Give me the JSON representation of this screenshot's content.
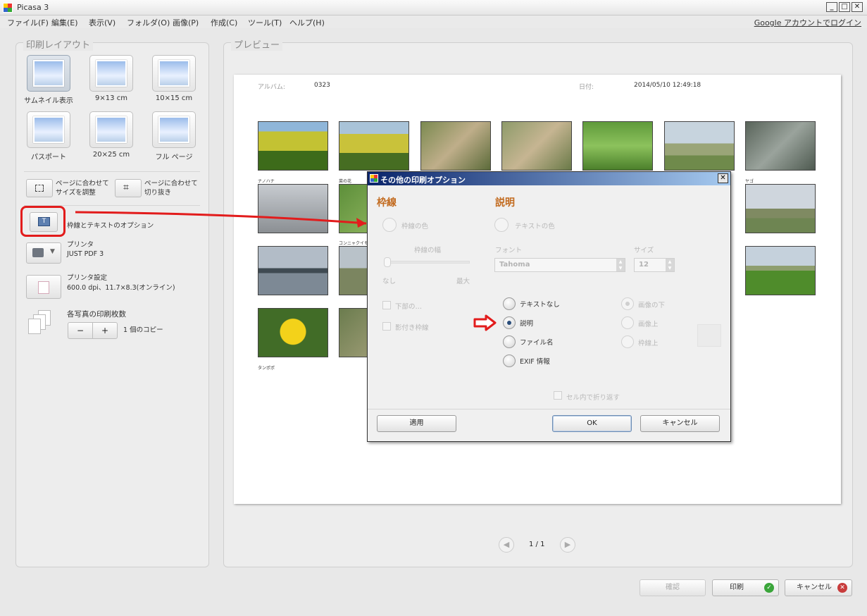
{
  "window": {
    "title": "Picasa 3"
  },
  "menu": [
    "ファイル(F)",
    "編集(E)",
    "表示(V)",
    "フォルダ(O)",
    "画像(P)",
    "作成(C)",
    "ツール(T)",
    "ヘルプ(H)"
  ],
  "login_link": "Google アカウントでログイン",
  "left": {
    "title": "印刷レイアウト",
    "layouts": [
      "サムネイル表示",
      "9×13 cm",
      "10×15 cm",
      "パスポート",
      "20×25 cm",
      "フル ページ"
    ],
    "fit_resize": "ページに合わせてサイズを調整",
    "fit_crop": "ページに合わせて切り抜き",
    "border_text": "枠線とテキストのオプション",
    "printer_label": "プリンタ",
    "printer_name": "JUST PDF 3",
    "printer_settings_label": "プリンタ設定",
    "printer_settings_value": "600.0 dpi、11.7×8.3(オンライン)",
    "copies_label": "各写真の印刷枚数",
    "minus": "−",
    "plus": "+",
    "copies_value": "1 個のコピー"
  },
  "preview": {
    "title": "プレビュー",
    "album_label": "アルバム:",
    "album_value": "0323",
    "date_label": "日付:",
    "date_value": "2014/05/10 12:49:18",
    "captions": [
      "ナノハナ",
      "菜の花",
      "ツクシ",
      "タンポポ",
      "コンニャクイモ？",
      "ヤゴ"
    ],
    "page": "1 / 1",
    "prev_arrow": "◀",
    "next_arrow": "▶"
  },
  "bottom": {
    "confirm": "確認",
    "print": "印刷",
    "cancel": "キャンセル",
    "check_glyph": "✓",
    "x_glyph": "✕"
  },
  "dialog": {
    "title": "その他の印刷オプション",
    "close_glyph": "✕",
    "border_heading": "枠線",
    "caption_heading": "説明",
    "border_color": "枠線の色",
    "text_color": "テキストの色",
    "border_width": "枠線の幅",
    "width_min": "なし",
    "width_max": "最大",
    "font_label": "フォント",
    "font_value": "Tahoma",
    "size_label": "サイズ",
    "size_value": "12",
    "spin_up": "▲",
    "spin_down": "▼",
    "check1": "下部の…",
    "check2": "影付き枠線",
    "text_options": [
      "テキストなし",
      "説明",
      "ファイル名",
      "EXIF 情報"
    ],
    "position_options": [
      "画像の下",
      "画像上",
      "枠線上"
    ],
    "wrap": "セル内で折り返す",
    "apply": "適用",
    "ok": "OK",
    "cancel": "キャンセル"
  },
  "colors": {
    "accent_heading": "#c26a1e",
    "annotation_red": "#e21c1c",
    "print_ok": "#3aa53a",
    "cancel_x": "#c83c3c"
  }
}
